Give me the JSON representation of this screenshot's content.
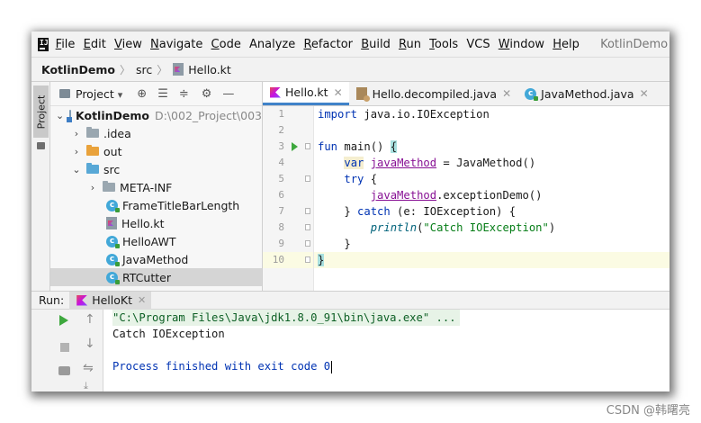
{
  "window": {
    "project_title": "KotlinDemo -"
  },
  "menubar": {
    "items": [
      {
        "u": "F",
        "rest": "ile"
      },
      {
        "u": "E",
        "rest": "dit"
      },
      {
        "u": "V",
        "rest": "iew"
      },
      {
        "u": "N",
        "rest": "avigate"
      },
      {
        "u": "C",
        "rest": "ode"
      },
      {
        "u": "",
        "rest": "Analyze"
      },
      {
        "u": "R",
        "rest": "efactor"
      },
      {
        "u": "B",
        "rest": "uild"
      },
      {
        "u": "R",
        "rest": "un"
      },
      {
        "u": "T",
        "rest": "ools"
      },
      {
        "u": "",
        "rest": "VCS"
      },
      {
        "u": "W",
        "rest": "indow"
      },
      {
        "u": "H",
        "rest": "elp"
      }
    ],
    "logo_text": "IJ"
  },
  "breadcrumb": {
    "project": "KotlinDemo",
    "folder": "src",
    "file": "Hello.kt"
  },
  "left_stripe": {
    "label": "Project"
  },
  "project_panel": {
    "title": "Project",
    "dropdown_glyph": "▾",
    "tree": {
      "root": "KotlinDemo",
      "root_path": "D:\\002_Project\\003",
      "idea": ".idea",
      "out": "out",
      "src": "src",
      "meta_inf": "META-INF",
      "files": [
        "FrameTitleBarLength",
        "Hello.kt",
        "HelloAWT",
        "JavaMethod",
        "RTCutter"
      ]
    }
  },
  "editor": {
    "tabs": [
      "Hello.kt",
      "Hello.decompiled.java",
      "JavaMethod.java"
    ],
    "line_numbers": [
      "1",
      "2",
      "3",
      "4",
      "5",
      "6",
      "7",
      "8",
      "9",
      "10"
    ],
    "code": {
      "l1_kw": "import",
      "l1_rest": " java.io.IOException",
      "l3_kw": "fun",
      "l3_name": " main() ",
      "l3_brace": "{",
      "l4_indent": "    ",
      "l4_kw": "var",
      "l4_var": "javaMethod",
      "l4_rest": " = JavaMethod()",
      "l5_indent": "    ",
      "l5_kw": "try",
      "l5_rest": " {",
      "l6_indent": "        ",
      "l6_var": "javaMethod",
      "l6_rest": ".exceptionDemo()",
      "l7_indent": "    } ",
      "l7_kw": "catch",
      "l7_rest": " (e: IOException) {",
      "l8_indent": "        ",
      "l8_fn": "println",
      "l8_open": "(",
      "l8_str": "\"Catch IOException\"",
      "l8_close": ")",
      "l9": "    }",
      "l10_brace": "}"
    }
  },
  "run_panel": {
    "label": "Run:",
    "tab": "HelloKt",
    "console": {
      "cmd": "\"C:\\Program Files\\Java\\jdk1.8.0_91\\bin\\java.exe\" ...",
      "output": "Catch IOException",
      "exit": "Process finished with exit code 0"
    }
  },
  "watermark": "CSDN @韩曙亮",
  "colors": {
    "accent": "#4083c9",
    "keyword": "#0033b3",
    "string": "#067d17",
    "run_green": "#3ea83e"
  }
}
